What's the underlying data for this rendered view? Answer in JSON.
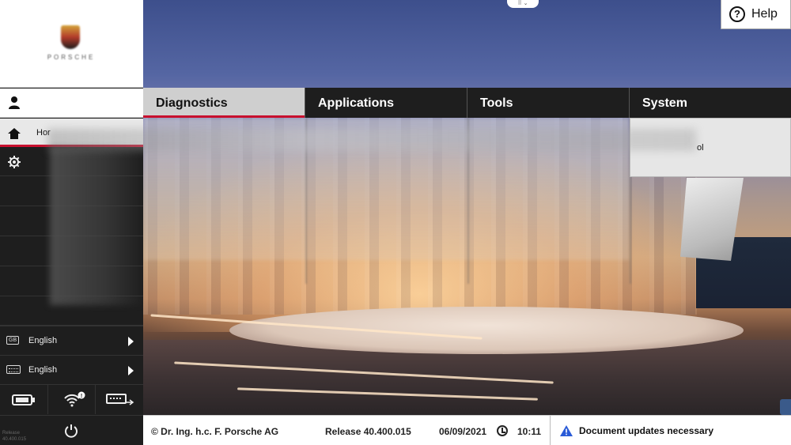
{
  "brand": {
    "wordmark": "PORSCHE"
  },
  "help": {
    "label": "Help",
    "icon": "question-circle-icon"
  },
  "handle": {
    "label": "⠿ ⌄"
  },
  "menu": {
    "items": [
      {
        "label": "Diagnostics",
        "active": true
      },
      {
        "label": "Applications",
        "active": false
      },
      {
        "label": "Tools",
        "active": false
      },
      {
        "label": "System",
        "active": false
      }
    ],
    "submenu_text": "ol"
  },
  "sidebar": {
    "home_label": "Hor",
    "languages": [
      {
        "badge": "GB",
        "label": "English"
      },
      {
        "badge": "",
        "label": "English"
      }
    ],
    "release_small": [
      "Release",
      "40.400.015"
    ],
    "wifi_badge": "!"
  },
  "footer": {
    "copyright": "© Dr. Ing. h.c. F. Porsche AG",
    "release": "Release 40.400.015",
    "date": "06/09/2021",
    "time": "10:11",
    "warning": "Document updates necessary"
  },
  "colors": {
    "accent": "#c8102e",
    "menubar": "#1e1e1e",
    "active_tab": "#cfcfcf",
    "warning_icon": "#2a5bd7"
  }
}
